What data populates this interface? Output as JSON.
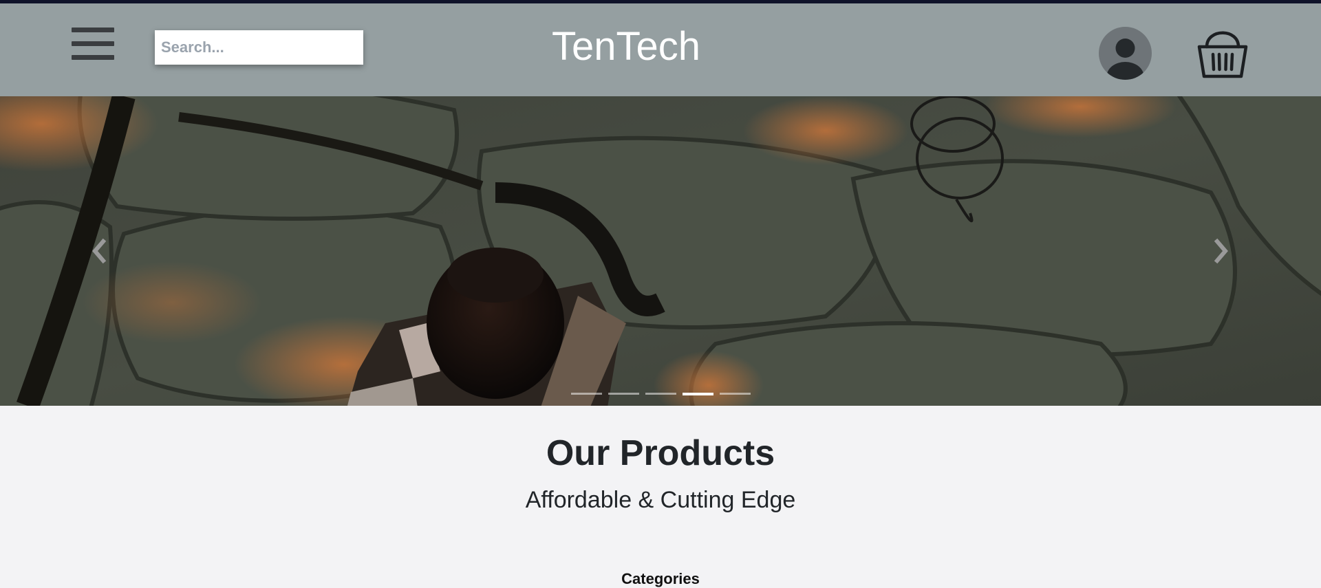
{
  "navbar": {
    "menu_icon": "hamburger-menu-icon",
    "search": {
      "placeholder": "Search...",
      "value": ""
    },
    "brand": "TenTech",
    "account_icon": "user-avatar-icon",
    "cart_icon": "shopping-basket-icon"
  },
  "carousel": {
    "image": "camera on olive quilted blanket",
    "prev_icon": "chevron-left-icon",
    "next_icon": "chevron-right-icon",
    "slide_count": 5,
    "active_slide": 4
  },
  "products": {
    "title": "Our Products",
    "subtitle": "Affordable & Cutting Edge",
    "categories_heading": "Categories"
  },
  "colors": {
    "navbar_bg": "#959fa1",
    "top_border": "#10132a",
    "page_bg": "#f3f3f5",
    "text_dark": "#212529"
  }
}
